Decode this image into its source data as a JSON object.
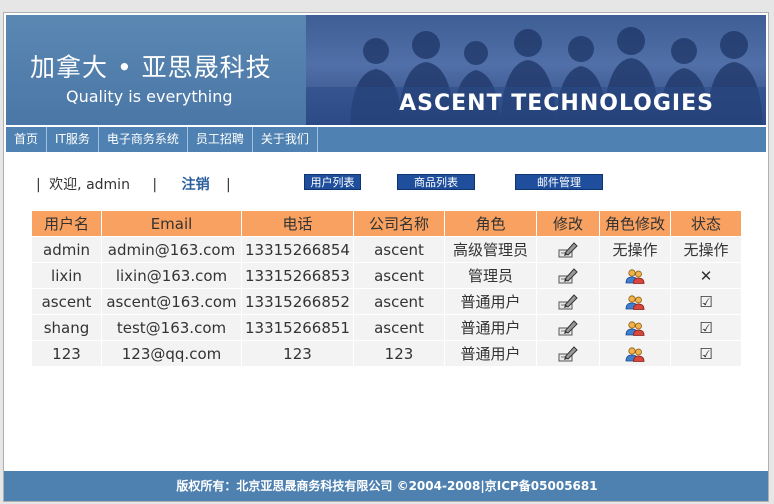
{
  "banner": {
    "brand_cn": "加拿大 • 亚思晟科技",
    "brand_en": "Quality is everything",
    "slogan": "ASCENT TECHNOLOGIES"
  },
  "nav": {
    "items": [
      {
        "label": "首页"
      },
      {
        "label": "IT服务"
      },
      {
        "label": "电子商务系统"
      },
      {
        "label": "员工招聘"
      },
      {
        "label": "关于我们"
      }
    ]
  },
  "welcome": {
    "text": "欢迎, admin",
    "logout": "注销"
  },
  "toolbar": {
    "user_list": "用户列表",
    "product_list": "商品列表",
    "mail_manage": "邮件管理"
  },
  "table": {
    "headers": [
      "用户名",
      "Email",
      "电话",
      "公司名称",
      "角色",
      "修改",
      "角色修改",
      "状态"
    ],
    "rows": [
      {
        "username": "admin",
        "email": "admin@163.com",
        "phone": "13315266854",
        "company": "ascent",
        "role": "高级管理员",
        "edit": "edit-icon",
        "role_edit": "无操作",
        "status": "无操作"
      },
      {
        "username": "lixin",
        "email": "lixin@163.com",
        "phone": "13315266853",
        "company": "ascent",
        "role": "管理员",
        "edit": "edit-icon",
        "role_edit": "users-icon",
        "status": "✕"
      },
      {
        "username": "ascent",
        "email": "ascent@163.com",
        "phone": "13315266852",
        "company": "ascent",
        "role": "普通用户",
        "edit": "edit-icon",
        "role_edit": "users-icon",
        "status": "☑"
      },
      {
        "username": "shang",
        "email": "test@163.com",
        "phone": "13315266851",
        "company": "ascent",
        "role": "普通用户",
        "edit": "edit-icon",
        "role_edit": "users-icon",
        "status": "☑"
      },
      {
        "username": "123",
        "email": "123@qq.com",
        "phone": "123",
        "company": "123",
        "role": "普通用户",
        "edit": "edit-icon",
        "role_edit": "users-icon",
        "status": "☑"
      }
    ]
  },
  "footer": {
    "text": "版权所有：北京亚思晟商务科技有限公司 ©2004-2008|京ICP备05005681"
  },
  "colors": {
    "banner_blue": "#4a77a6",
    "nav_blue": "#4f82b2",
    "header_orange": "#f9a160",
    "button_blue": "#1f4f9c",
    "footer_blue": "#4e80b0"
  }
}
